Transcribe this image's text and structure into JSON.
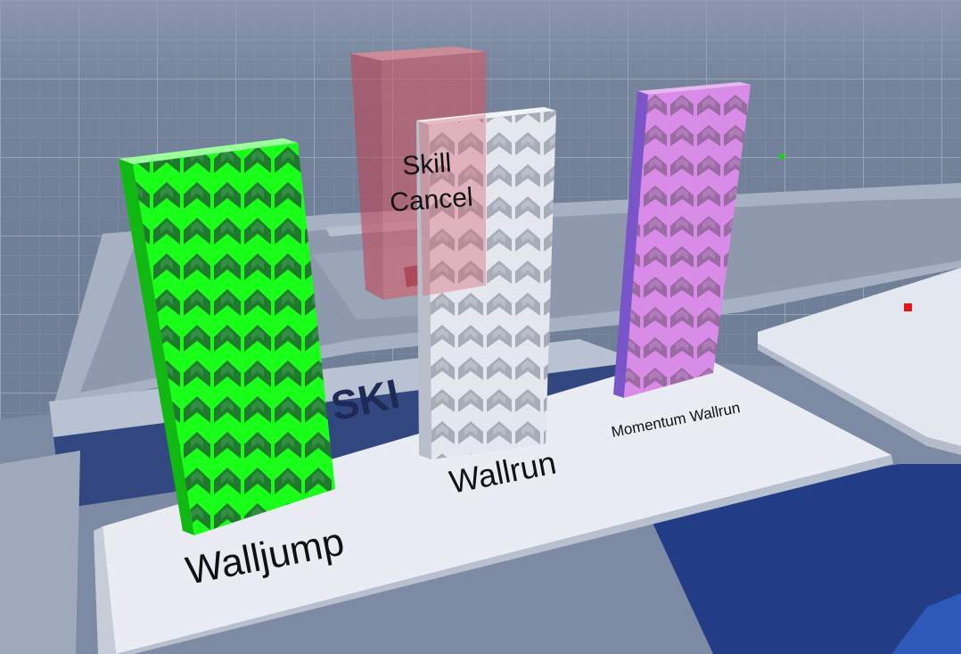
{
  "scene": {
    "walls": [
      {
        "id": "walljump",
        "label": "Walljump",
        "color": "#1aff1a"
      },
      {
        "id": "wallrun",
        "label": "Wallrun",
        "color": "#dfe3ea"
      },
      {
        "id": "momentum-wallrun",
        "label": "Momentum Wallrun",
        "color": "#d27ee0"
      },
      {
        "id": "skill-cancel",
        "label_line1": "Skill",
        "label_line2": "Cancel",
        "color": "#d9535f"
      }
    ],
    "floor_text": "SKI"
  }
}
